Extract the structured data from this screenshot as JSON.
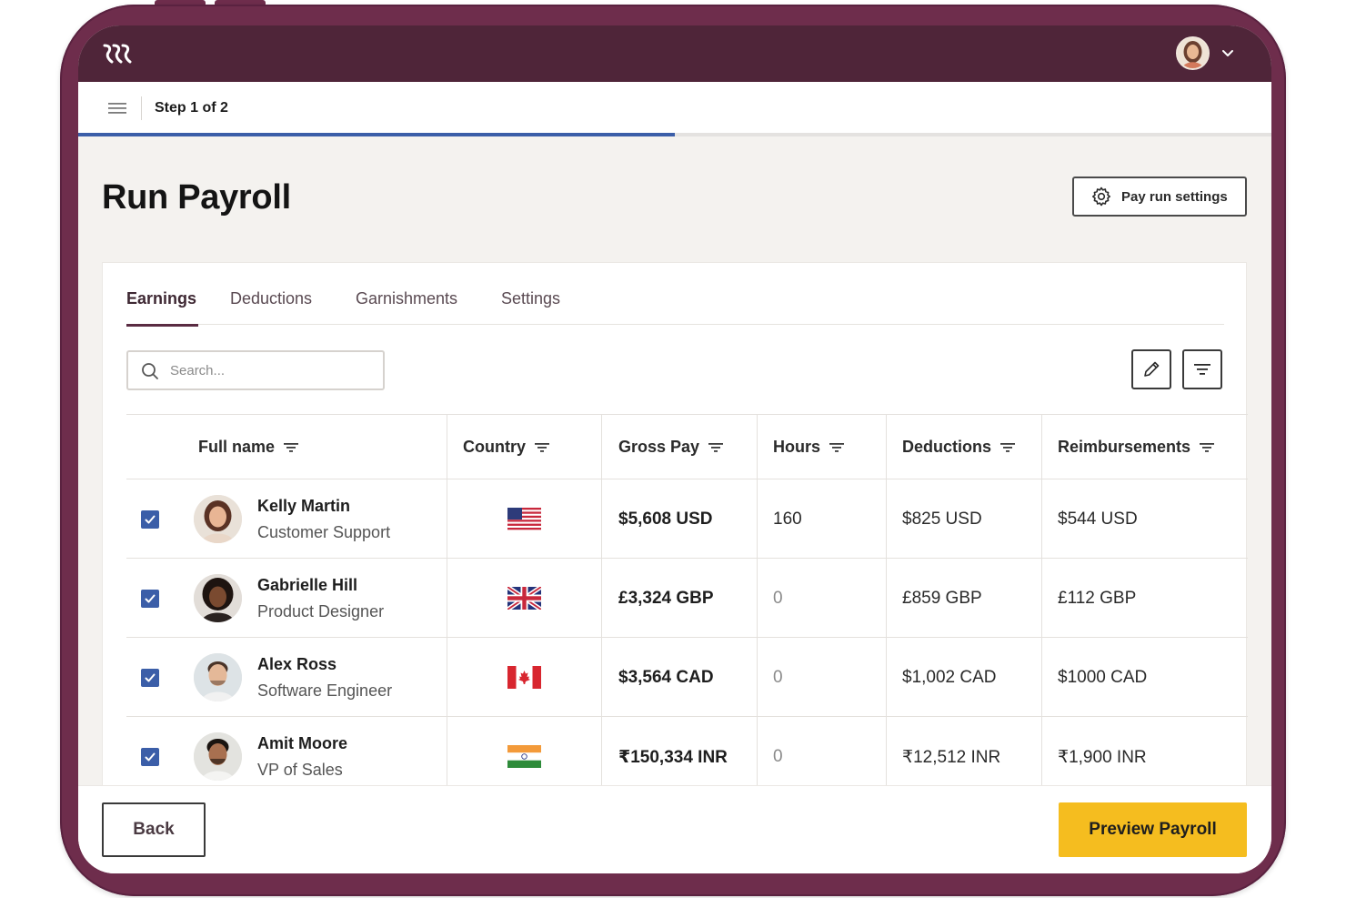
{
  "header": {
    "logo": "rippling-logo",
    "avatar": "user-avatar"
  },
  "stepbar": {
    "step_label": "Step 1 of 2",
    "progress": 0.5
  },
  "page": {
    "title": "Run Payroll",
    "settings_label": "Pay run settings"
  },
  "tabs": [
    {
      "label": "Earnings",
      "active": true
    },
    {
      "label": "Deductions",
      "active": false
    },
    {
      "label": "Garnishments",
      "active": false
    },
    {
      "label": "Settings",
      "active": false
    }
  ],
  "search": {
    "placeholder": "Search..."
  },
  "table": {
    "columns": [
      "Full name",
      "Country",
      "Gross Pay",
      "Hours",
      "Deductions",
      "Reimbursements"
    ],
    "rows": [
      {
        "checked": true,
        "name": "Kelly Martin",
        "role": "Customer Support",
        "country_flag": "us-flag",
        "gross_pay": "$5,608 USD",
        "hours": "160",
        "deductions": "$825 USD",
        "reimbursements": "$544 USD"
      },
      {
        "checked": true,
        "name": "Gabrielle Hill",
        "role": "Product Designer",
        "country_flag": "uk-flag",
        "gross_pay": "£3,324 GBP",
        "hours": "0",
        "deductions": "£859 GBP",
        "reimbursements": "£112 GBP"
      },
      {
        "checked": true,
        "name": "Alex Ross",
        "role": "Software Engineer",
        "country_flag": "canada-flag",
        "gross_pay": "$3,564 CAD",
        "hours": "0",
        "deductions": "$1,002 CAD",
        "reimbursements": "$1000 CAD"
      },
      {
        "checked": true,
        "name": "Amit Moore",
        "role": "VP of Sales",
        "country_flag": "india-flag",
        "gross_pay": "₹150,334 INR",
        "hours": "0",
        "deductions": "₹12,512 INR",
        "reimbursements": "₹1,900 INR"
      }
    ]
  },
  "footer": {
    "back_label": "Back",
    "preview_label": "Preview Payroll"
  },
  "colors": {
    "frame": "#6e2d4c",
    "topbar": "#4f2539",
    "accent": "#3b5ea8",
    "cta": "#f5bd1f"
  }
}
